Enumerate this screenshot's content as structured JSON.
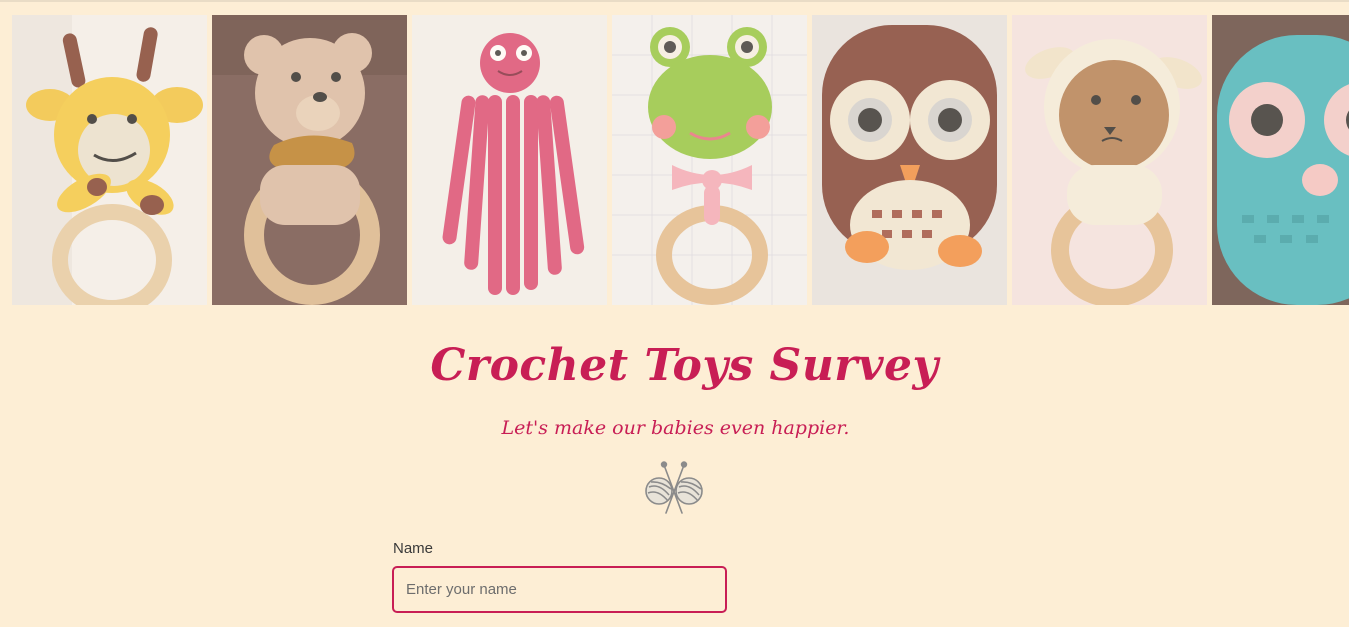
{
  "header": {
    "gallery": [
      {
        "name": "giraffe-rattle-photo"
      },
      {
        "name": "bear-rattle-photo"
      },
      {
        "name": "octopus-photo"
      },
      {
        "name": "frog-rattle-photo"
      },
      {
        "name": "owl-brown-photo"
      },
      {
        "name": "lamb-rattle-photo"
      },
      {
        "name": "owl-teal-photo"
      }
    ]
  },
  "main": {
    "title": "Crochet Toys Survey",
    "subtitle": "Let's make our babies even happier.",
    "logo_icon": "yarn-knitting-needles-icon"
  },
  "form": {
    "name_label": "Name",
    "name_placeholder": "Enter your name",
    "name_value": ""
  },
  "colors": {
    "background": "#fdeed5",
    "accent": "#c81e55",
    "label_text": "#3a3a3a"
  }
}
